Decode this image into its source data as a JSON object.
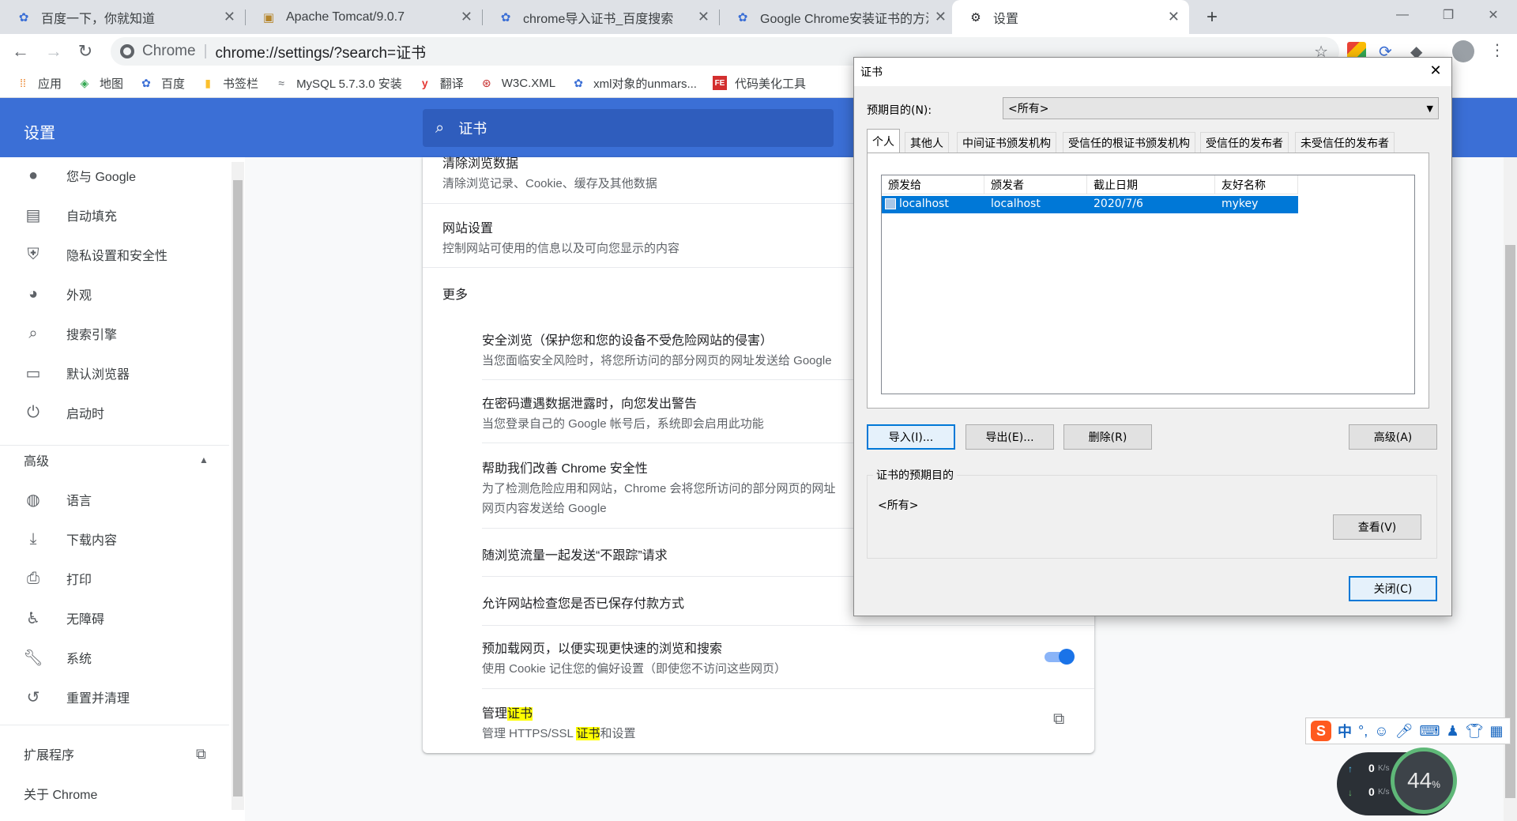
{
  "tabs": [
    {
      "title": "百度一下，你就知道",
      "icon": "baidu-paw-icon"
    },
    {
      "title": "Apache Tomcat/9.0.7",
      "icon": "tomcat-icon"
    },
    {
      "title": "chrome导入证书_百度搜索",
      "icon": "baidu-paw-icon"
    },
    {
      "title": "Google Chrome安装证书的方法",
      "icon": "baidu-paw-icon"
    },
    {
      "title": "设置",
      "icon": "gear-icon"
    }
  ],
  "toolbar": {
    "site_label": "Chrome",
    "url": "chrome://settings/?search=证书"
  },
  "bookmarks": [
    "应用",
    "地图",
    "百度",
    "书签栏",
    "MySQL 5.7.3.0 安装",
    "翻译",
    "W3C.XML",
    "xml对象的unmars...",
    "代码美化工具"
  ],
  "settings": {
    "title": "设置",
    "search_value": "证书"
  },
  "sidebar": {
    "items": [
      {
        "label": "您与 Google",
        "icon": "person-icon"
      },
      {
        "label": "自动填充",
        "icon": "clipboard-icon"
      },
      {
        "label": "隐私设置和安全性",
        "icon": "shield-icon"
      },
      {
        "label": "外观",
        "icon": "palette-icon"
      },
      {
        "label": "搜索引擎",
        "icon": "search-icon"
      },
      {
        "label": "默认浏览器",
        "icon": "browser-icon"
      },
      {
        "label": "启动时",
        "icon": "power-icon"
      }
    ],
    "advanced_label": "高级",
    "advanced_items": [
      {
        "label": "语言",
        "icon": "globe-icon"
      },
      {
        "label": "下载内容",
        "icon": "download-icon"
      },
      {
        "label": "打印",
        "icon": "printer-icon"
      },
      {
        "label": "无障碍",
        "icon": "accessibility-icon"
      },
      {
        "label": "系统",
        "icon": "wrench-icon"
      },
      {
        "label": "重置并清理",
        "icon": "history-icon"
      }
    ],
    "extensions_label": "扩展程序",
    "about_label": "关于 Chrome"
  },
  "main": {
    "clear_title": "清除浏览数据",
    "clear_sub": "清除浏览记录、Cookie、缓存及其他数据",
    "site_title": "网站设置",
    "site_sub": "控制网站可使用的信息以及可向您显示的内容",
    "more_label": "更多",
    "safe_title": "安全浏览（保护您和您的设备不受危险网站的侵害）",
    "safe_sub": "当您面临安全风险时，将您所访问的部分网页的网址发送给 Google",
    "leak_title": "在密码遭遇数据泄露时，向您发出警告",
    "leak_sub": "当您登录自己的 Google 帐号后，系统即会启用此功能",
    "improve_title": "帮助我们改善 Chrome 安全性",
    "improve_sub1": "为了检测危险应用和网站，Chrome 会将您所访问的部分网页的网址",
    "improve_sub2": "网页内容发送给 Google",
    "dnt_title": "随浏览流量一起发送“不跟踪”请求",
    "payment_title": "允许网站检查您是否已保存付款方式",
    "preload_title": "预加载网页，以便实现更快速的浏览和搜索",
    "preload_sub": "使用 Cookie 记住您的偏好设置（即使您不访问这些网页）",
    "preload_enabled": true,
    "manage_title_pre": "管理",
    "manage_title_hl": "证书",
    "manage_sub_pre": "管理 HTTPS/SSL ",
    "manage_sub_hl": "证书",
    "manage_sub_post": "和设置"
  },
  "dialog": {
    "title": "证书",
    "purpose_label": "预期目的(N):",
    "purpose_value": "<所有>",
    "tabs": [
      "个人",
      "其他人",
      "中间证书颁发机构",
      "受信任的根证书颁发机构",
      "受信任的发布者",
      "未受信任的发布者"
    ],
    "columns": [
      "颁发给",
      "颁发者",
      "截止日期",
      "友好名称"
    ],
    "rows": [
      {
        "issued_to": "localhost",
        "issuer": "localhost",
        "expiry": "2020/7/6",
        "friendly": "mykey"
      }
    ],
    "buttons": {
      "import": "导入(I)...",
      "export": "导出(E)...",
      "remove": "删除(R)",
      "advanced": "高级(A)",
      "view": "查看(V)",
      "close": "关闭(C)"
    },
    "group_label": "证书的预期目的",
    "group_value": "<所有>"
  },
  "ime": {
    "mode": "中"
  },
  "netmon": {
    "up": "0",
    "down": "0",
    "unit": "K/s",
    "percent": "44",
    "percent_sign": "%"
  }
}
